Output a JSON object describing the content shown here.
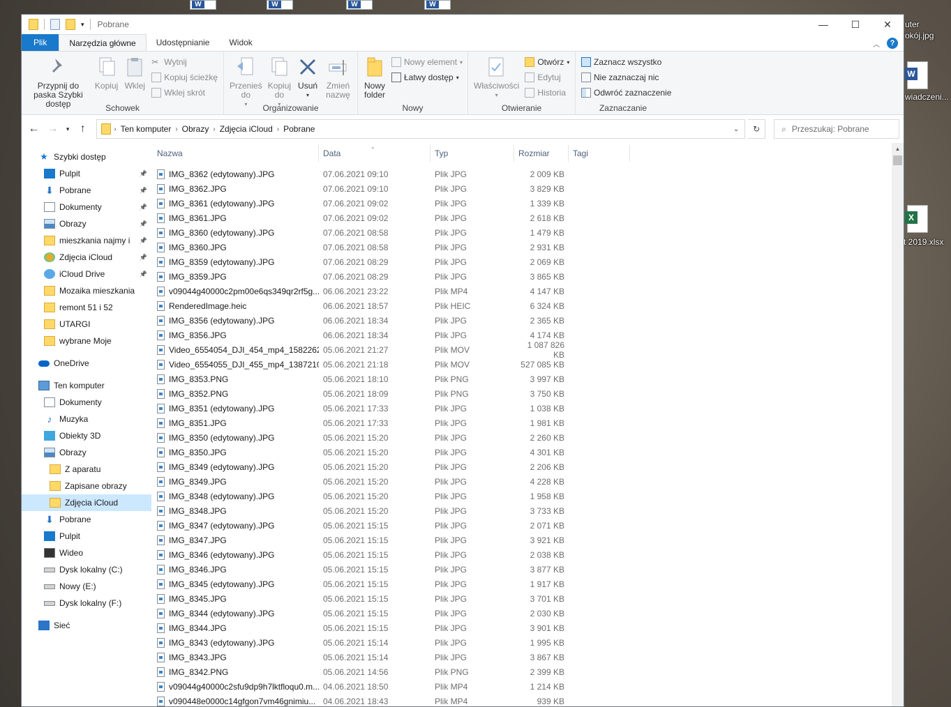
{
  "desktop": {
    "labels": [
      "uter",
      "okój.jpg",
      "wiadczeni...",
      "t 2019.xlsx"
    ]
  },
  "window": {
    "title": "Pobrane",
    "controls": {
      "minimize": "—",
      "maximize": "☐",
      "close": "✕"
    }
  },
  "ribbon_tabs": [
    "Plik",
    "Narzędzia główne",
    "Udostępnianie",
    "Widok"
  ],
  "ribbon": {
    "clipboard": {
      "label": "Schowek",
      "pin": "Przypnij do paska Szybki dostęp",
      "copy": "Kopiuj",
      "paste": "Wklej",
      "cut": "Wytnij",
      "copy_path": "Kopiuj ścieżkę",
      "paste_shortcut": "Wklej skrót"
    },
    "organize": {
      "label": "Organizowanie",
      "move_to": "Przenieś do",
      "copy_to": "Kopiuj do",
      "delete": "Usuń",
      "rename": "Zmień nazwę"
    },
    "new": {
      "label": "Nowy",
      "new_folder": "Nowy folder",
      "new_item": "Nowy element",
      "easy_access": "Łatwy dostęp"
    },
    "open": {
      "label": "Otwieranie",
      "properties": "Właściwości",
      "open": "Otwórz",
      "edit": "Edytuj",
      "history": "Historia"
    },
    "select": {
      "label": "Zaznaczanie",
      "select_all": "Zaznacz wszystko",
      "select_none": "Nie zaznaczaj nic",
      "invert": "Odwróć zaznaczenie"
    }
  },
  "address": {
    "crumbs": [
      "Ten komputer",
      "Obrazy",
      "Zdjęcia iCloud",
      "Pobrane"
    ],
    "search_placeholder": "Przeszukaj: Pobrane"
  },
  "nav": [
    {
      "label": "Szybki dostęp",
      "icon": "star-icon",
      "indent": 0,
      "pinned": false
    },
    {
      "label": "Pulpit",
      "icon": "desktop-icon",
      "indent": 1,
      "pinned": true
    },
    {
      "label": "Pobrane",
      "icon": "download-icon",
      "indent": 1,
      "pinned": true
    },
    {
      "label": "Dokumenty",
      "icon": "document-icon",
      "indent": 1,
      "pinned": true
    },
    {
      "label": "Obrazy",
      "icon": "pictures-icon",
      "indent": 1,
      "pinned": true
    },
    {
      "label": "mieszkania najmy i",
      "icon": "folder-icon",
      "indent": 1,
      "pinned": true
    },
    {
      "label": "Zdjęcia iCloud",
      "icon": "icloud-photos-icon",
      "indent": 1,
      "pinned": true
    },
    {
      "label": "iCloud Drive",
      "icon": "icloud-drive-icon",
      "indent": 1,
      "pinned": true
    },
    {
      "label": "Mozaika mieszkania",
      "icon": "folder-icon",
      "indent": 1,
      "pinned": false
    },
    {
      "label": "remont 51 i 52",
      "icon": "folder-icon",
      "indent": 1,
      "pinned": false
    },
    {
      "label": "UTARGI",
      "icon": "folder-icon",
      "indent": 1,
      "pinned": false
    },
    {
      "label": "wybrane Moje",
      "icon": "folder-icon",
      "indent": 1,
      "pinned": false
    },
    {
      "label": "",
      "icon": "",
      "indent": 0,
      "pinned": false
    },
    {
      "label": "OneDrive",
      "icon": "onedrive-icon",
      "indent": 0,
      "pinned": false
    },
    {
      "label": "",
      "icon": "",
      "indent": 0,
      "pinned": false
    },
    {
      "label": "Ten komputer",
      "icon": "computer-icon",
      "indent": 0,
      "pinned": false
    },
    {
      "label": "Dokumenty",
      "icon": "document-icon",
      "indent": 1,
      "pinned": false
    },
    {
      "label": "Muzyka",
      "icon": "music-icon",
      "indent": 1,
      "pinned": false
    },
    {
      "label": "Obiekty 3D",
      "icon": "cube-icon",
      "indent": 1,
      "pinned": false
    },
    {
      "label": "Obrazy",
      "icon": "pictures-icon",
      "indent": 1,
      "pinned": false
    },
    {
      "label": "Z aparatu",
      "icon": "folder-icon",
      "indent": 2,
      "pinned": false
    },
    {
      "label": "Zapisane obrazy",
      "icon": "folder-icon",
      "indent": 2,
      "pinned": false
    },
    {
      "label": "Zdjęcia iCloud",
      "icon": "folder-icon",
      "indent": 2,
      "pinned": false,
      "selected": true
    },
    {
      "label": "Pobrane",
      "icon": "download-icon",
      "indent": 1,
      "pinned": false
    },
    {
      "label": "Pulpit",
      "icon": "desktop-icon",
      "indent": 1,
      "pinned": false
    },
    {
      "label": "Wideo",
      "icon": "video-icon",
      "indent": 1,
      "pinned": false
    },
    {
      "label": "Dysk lokalny (C:)",
      "icon": "drive-c-icon",
      "indent": 1,
      "pinned": false
    },
    {
      "label": "Nowy (E:)",
      "icon": "drive-icon",
      "indent": 1,
      "pinned": false
    },
    {
      "label": "Dysk lokalny (F:)",
      "icon": "drive-icon",
      "indent": 1,
      "pinned": false
    },
    {
      "label": "",
      "icon": "",
      "indent": 0,
      "pinned": false
    },
    {
      "label": "Sieć",
      "icon": "network-icon",
      "indent": 0,
      "pinned": false
    }
  ],
  "columns": {
    "name": "Nazwa",
    "date": "Data",
    "type": "Typ",
    "size": "Rozmiar",
    "tags": "Tagi"
  },
  "files": [
    [
      "IMG_8362  (edytowany).JPG",
      "07.06.2021 09:10",
      "Plik JPG",
      "2 009 KB"
    ],
    [
      "IMG_8362.JPG",
      "07.06.2021 09:10",
      "Plik JPG",
      "3 829 KB"
    ],
    [
      "IMG_8361  (edytowany).JPG",
      "07.06.2021 09:02",
      "Plik JPG",
      "1 339 KB"
    ],
    [
      "IMG_8361.JPG",
      "07.06.2021 09:02",
      "Plik JPG",
      "2 618 KB"
    ],
    [
      "IMG_8360  (edytowany).JPG",
      "07.06.2021 08:58",
      "Plik JPG",
      "1 479 KB"
    ],
    [
      "IMG_8360.JPG",
      "07.06.2021 08:58",
      "Plik JPG",
      "2 931 KB"
    ],
    [
      "IMG_8359  (edytowany).JPG",
      "07.06.2021 08:29",
      "Plik JPG",
      "2 069 KB"
    ],
    [
      "IMG_8359.JPG",
      "07.06.2021 08:29",
      "Plik JPG",
      "3 865 KB"
    ],
    [
      "v09044g40000c2pm00e6qs349qr2rf5g....",
      "06.06.2021 23:22",
      "Plik MP4",
      "4 147 KB"
    ],
    [
      "RenderedImage.heic",
      "06.06.2021 18:57",
      "Plik HEIC",
      "6 324 KB"
    ],
    [
      "IMG_8356  (edytowany).JPG",
      "06.06.2021 18:34",
      "Plik JPG",
      "2 365 KB"
    ],
    [
      "IMG_8356.JPG",
      "06.06.2021 18:34",
      "Plik JPG",
      "4 174 KB"
    ],
    [
      "Video_6554054_DJI_454_mp4_1582262...",
      "05.06.2021 21:27",
      "Plik MOV",
      "1 087 826 KB"
    ],
    [
      "Video_6554055_DJI_455_mp4_1387210...",
      "05.06.2021 21:18",
      "Plik MOV",
      "527 085 KB"
    ],
    [
      "IMG_8353.PNG",
      "05.06.2021 18:10",
      "Plik PNG",
      "3 997 KB"
    ],
    [
      "IMG_8352.PNG",
      "05.06.2021 18:09",
      "Plik PNG",
      "3 750 KB"
    ],
    [
      "IMG_8351  (edytowany).JPG",
      "05.06.2021 17:33",
      "Plik JPG",
      "1 038 KB"
    ],
    [
      "IMG_8351.JPG",
      "05.06.2021 17:33",
      "Plik JPG",
      "1 981 KB"
    ],
    [
      "IMG_8350  (edytowany).JPG",
      "05.06.2021 15:20",
      "Plik JPG",
      "2 260 KB"
    ],
    [
      "IMG_8350.JPG",
      "05.06.2021 15:20",
      "Plik JPG",
      "4 301 KB"
    ],
    [
      "IMG_8349  (edytowany).JPG",
      "05.06.2021 15:20",
      "Plik JPG",
      "2 206 KB"
    ],
    [
      "IMG_8349.JPG",
      "05.06.2021 15:20",
      "Plik JPG",
      "4 228 KB"
    ],
    [
      "IMG_8348  (edytowany).JPG",
      "05.06.2021 15:20",
      "Plik JPG",
      "1 958 KB"
    ],
    [
      "IMG_8348.JPG",
      "05.06.2021 15:20",
      "Plik JPG",
      "3 733 KB"
    ],
    [
      "IMG_8347  (edytowany).JPG",
      "05.06.2021 15:15",
      "Plik JPG",
      "2 071 KB"
    ],
    [
      "IMG_8347.JPG",
      "05.06.2021 15:15",
      "Plik JPG",
      "3 921 KB"
    ],
    [
      "IMG_8346  (edytowany).JPG",
      "05.06.2021 15:15",
      "Plik JPG",
      "2 038 KB"
    ],
    [
      "IMG_8346.JPG",
      "05.06.2021 15:15",
      "Plik JPG",
      "3 877 KB"
    ],
    [
      "IMG_8345  (edytowany).JPG",
      "05.06.2021 15:15",
      "Plik JPG",
      "1 917 KB"
    ],
    [
      "IMG_8345.JPG",
      "05.06.2021 15:15",
      "Plik JPG",
      "3 701 KB"
    ],
    [
      "IMG_8344  (edytowany).JPG",
      "05.06.2021 15:15",
      "Plik JPG",
      "2 030 KB"
    ],
    [
      "IMG_8344.JPG",
      "05.06.2021 15:15",
      "Plik JPG",
      "3 901 KB"
    ],
    [
      "IMG_8343  (edytowany).JPG",
      "05.06.2021 15:14",
      "Plik JPG",
      "1 995 KB"
    ],
    [
      "IMG_8343.JPG",
      "05.06.2021 15:14",
      "Plik JPG",
      "3 867 KB"
    ],
    [
      "IMG_8342.PNG",
      "05.06.2021 14:56",
      "Plik PNG",
      "2 399 KB"
    ],
    [
      "v09044g40000c2sfu9dp9h7lktfloqu0.m...",
      "04.06.2021 18:50",
      "Plik MP4",
      "1 214 KB"
    ],
    [
      "v090448e0000c14gfgon7vm46gnimiu...",
      "04.06.2021 18:43",
      "Plik MP4",
      "939 KB"
    ]
  ]
}
